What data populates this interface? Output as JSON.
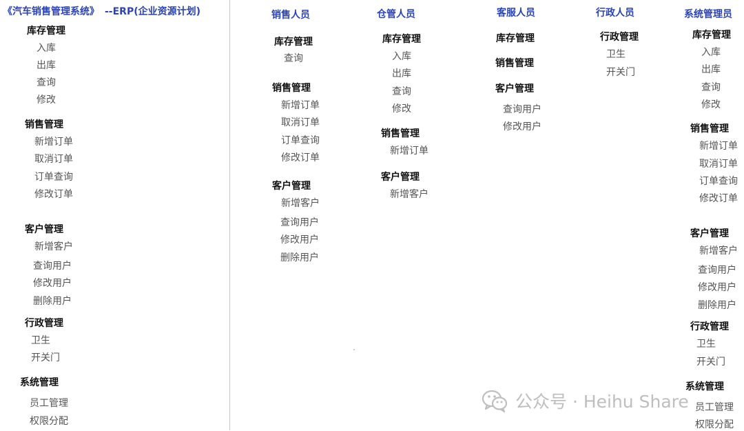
{
  "header": {
    "system_name": "《汽车销售管理系统》",
    "subtitle": "--ERP(企业资源计划)"
  },
  "overview": {
    "inventory": {
      "title": "库存管理",
      "items": [
        "入库",
        "出库",
        "查询",
        "修改"
      ]
    },
    "sales": {
      "title": "销售管理",
      "items": [
        "新增订单",
        "取消订单",
        "订单查询",
        "修改订单"
      ]
    },
    "customer": {
      "title": "客户管理",
      "items": [
        "新增客户",
        "查询用户",
        "修改用户",
        "删除用户"
      ]
    },
    "admin": {
      "title": "行政管理",
      "items": [
        "卫生",
        "开关门"
      ]
    },
    "system": {
      "title": "系统管理",
      "items": [
        "员工管理",
        "权限分配"
      ]
    }
  },
  "roles": {
    "sales": {
      "name": "销售人员",
      "inventory": {
        "title": "库存管理",
        "items": [
          "查询"
        ]
      },
      "sales": {
        "title": "销售管理",
        "items": [
          "新增订单",
          "取消订单",
          "订单查询",
          "修改订单"
        ]
      },
      "customer": {
        "title": "客户管理",
        "items": [
          "新增客户",
          "查询用户",
          "修改用户",
          "删除用户"
        ]
      }
    },
    "warehouse": {
      "name": "仓管人员",
      "inventory": {
        "title": "库存管理",
        "items": [
          "入库",
          "出库",
          "查询",
          "修改"
        ]
      },
      "sales": {
        "title": "销售管理",
        "items": [
          "新增订单"
        ]
      },
      "customer": {
        "title": "客户管理",
        "items": [
          "新增客户"
        ]
      }
    },
    "service": {
      "name": "客服人员",
      "inventory": {
        "title": "库存管理"
      },
      "sales": {
        "title": "销售管理"
      },
      "customer": {
        "title": "客户管理",
        "items": [
          "查询用户",
          "修改用户"
        ]
      }
    },
    "admin": {
      "name": "行政人员",
      "admin": {
        "title": "行政管理",
        "items": [
          "卫生",
          "开关门"
        ]
      }
    },
    "sysadmin": {
      "name": "系统管理员",
      "inventory": {
        "title": "库存管理",
        "items": [
          "入库",
          "出库",
          "查询",
          "修改"
        ]
      },
      "sales": {
        "title": "销售管理",
        "items": [
          "新增订单",
          "取消订单",
          "订单查询",
          "修改订单"
        ]
      },
      "customer": {
        "title": "客户管理",
        "items": [
          "新增客户",
          "查询用户",
          "修改用户",
          "删除用户"
        ]
      },
      "admin": {
        "title": "行政管理",
        "items": [
          "卫生",
          "开关门"
        ]
      },
      "system": {
        "title": "系统管理",
        "items": [
          "员工管理",
          "权限分配"
        ]
      }
    }
  },
  "watermark": {
    "text": "公众号 · Heihu Share",
    "icon": "wechat-icon"
  }
}
